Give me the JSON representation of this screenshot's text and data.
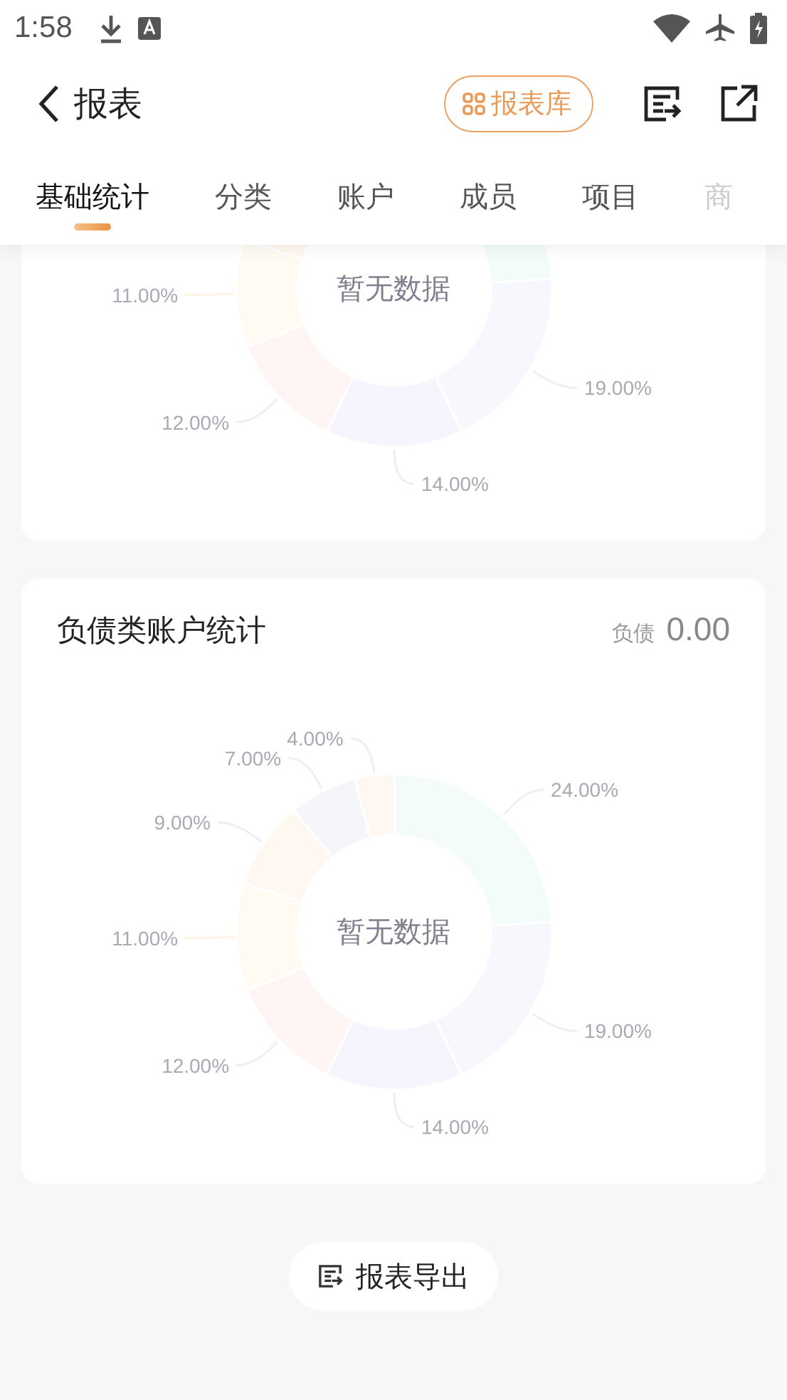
{
  "status_bar": {
    "time": "1:58"
  },
  "header": {
    "title": "报表",
    "library_button": "报表库"
  },
  "tabs": [
    {
      "label": "基础统计",
      "selected": true,
      "faded": false
    },
    {
      "label": "分类",
      "selected": false,
      "faded": false
    },
    {
      "label": "账户",
      "selected": false,
      "faded": false
    },
    {
      "label": "成员",
      "selected": false,
      "faded": false
    },
    {
      "label": "项目",
      "selected": false,
      "faded": false
    },
    {
      "label": "商",
      "selected": false,
      "faded": true
    }
  ],
  "cards": [
    {
      "empty_text": "暂无数据",
      "chart_data": {
        "type": "donut",
        "values": [
          24,
          19,
          14,
          12,
          11,
          9
        ],
        "colors": [
          "#f3fcfa",
          "#f7f8fe",
          "#f6f5fe",
          "#fff5f5",
          "#fffbf3",
          "#fef8f1"
        ],
        "value_labels": [
          null,
          "19.00%",
          "14.00%",
          "12.00%",
          "11.00%",
          null
        ]
      }
    },
    {
      "title": "负债类账户统计",
      "summary_label": "负债",
      "summary_value": "0.00",
      "empty_text": "暂无数据",
      "chart_data": {
        "type": "donut",
        "values": [
          24,
          19,
          14,
          12,
          11,
          9,
          7,
          4
        ],
        "colors": [
          "#f3fcfa",
          "#f7f8fe",
          "#f6f5fe",
          "#fff5f5",
          "#fffbf3",
          "#fef8f1",
          "#f6f6fa",
          "#fff7f2"
        ],
        "value_labels": [
          "24.00%",
          "19.00%",
          "14.00%",
          "12.00%",
          "11.00%",
          "9.00%",
          "7.00%",
          "4.00%"
        ]
      }
    }
  ],
  "export_button": "报表导出"
}
